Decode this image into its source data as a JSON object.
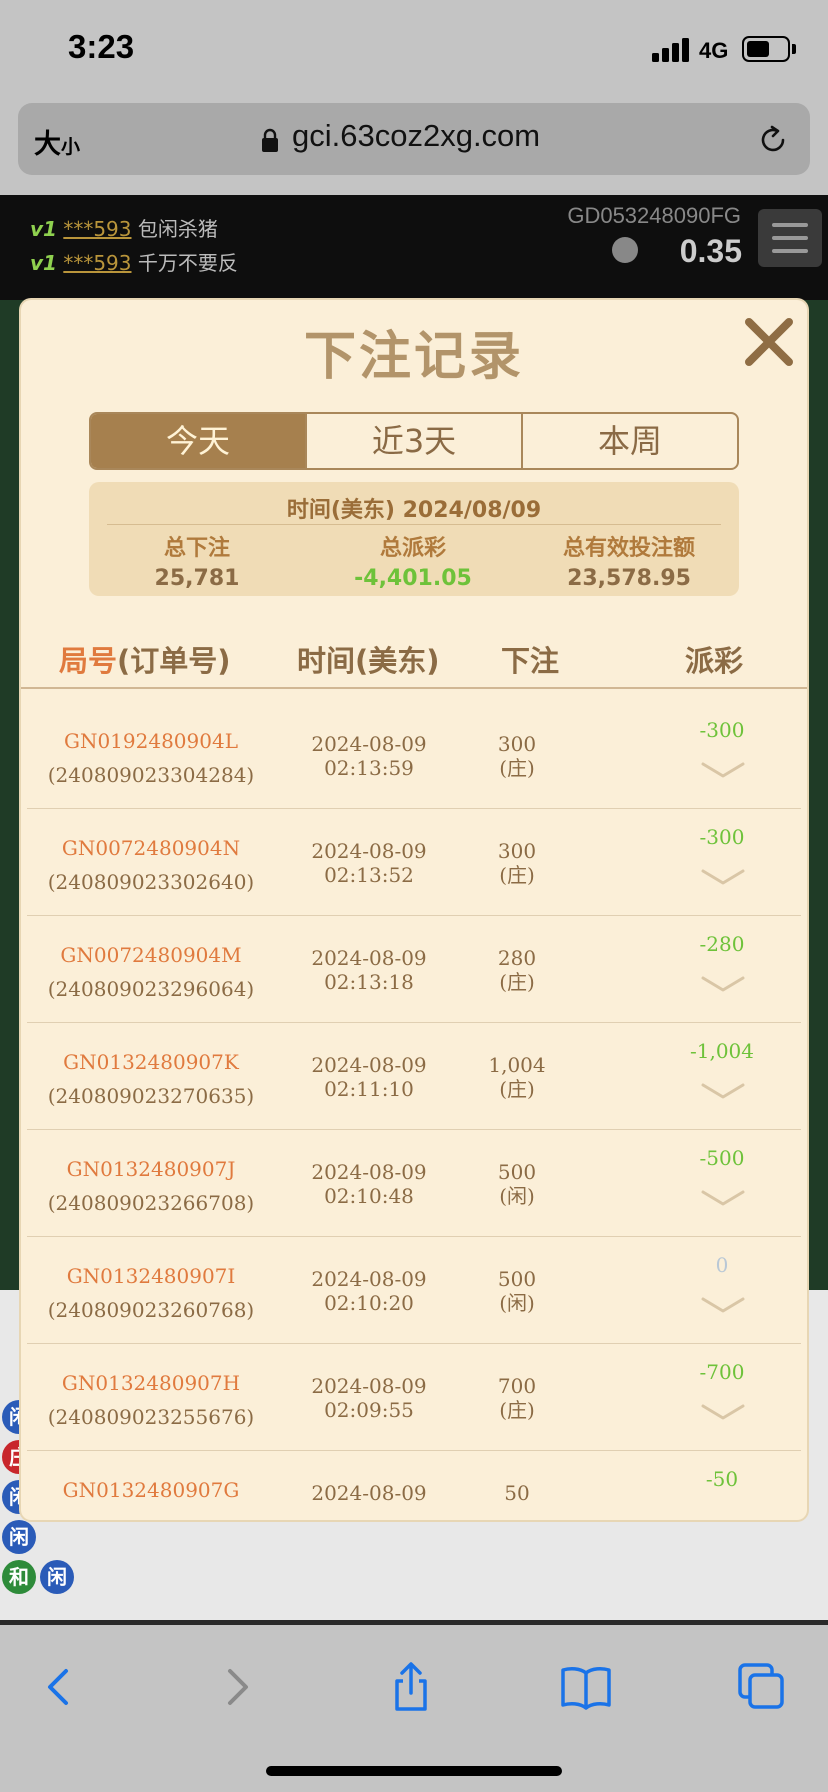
{
  "status": {
    "time": "3:23",
    "network": "4G"
  },
  "browser": {
    "text_size_label": "大",
    "text_size_small": "小",
    "url": "gci.63coz2xg.com"
  },
  "game": {
    "chat": [
      {
        "vip": "v1",
        "user": "***593",
        "message": "包闲杀猪"
      },
      {
        "vip": "v1",
        "user": "***593",
        "message": "千万不要反"
      }
    ],
    "account_id": "GD053248090FG",
    "balance": "0.35",
    "roadmap_labels": [
      "闲",
      "庄",
      "闲",
      "闲",
      "和",
      "闲"
    ]
  },
  "modal": {
    "title": "下注记录",
    "tabs": [
      {
        "label": "今天",
        "active": true
      },
      {
        "label": "近3天",
        "active": false
      },
      {
        "label": "本周",
        "active": false
      }
    ],
    "summary": {
      "date_label": "时间(美东)",
      "date": "2024/08/09",
      "total_bet_label": "总下注",
      "total_bet": "25,781",
      "total_payout_label": "总派彩",
      "total_payout": "-4,401.05",
      "total_valid_label": "总有效投注额",
      "total_valid": "23,578.95"
    },
    "columns": {
      "round_a": "局号",
      "round_b": "(订单号)",
      "time": "时间(美东)",
      "bet": "下注",
      "payout": "派彩"
    },
    "rows": [
      {
        "game_no": "GN0192480904L",
        "order_no": "(240809023304284)",
        "date": "2024-08-09",
        "time": "02:13:59",
        "amount": "300",
        "side": "(庄)",
        "payout": "-300"
      },
      {
        "game_no": "GN0072480904N",
        "order_no": "(240809023302640)",
        "date": "2024-08-09",
        "time": "02:13:52",
        "amount": "300",
        "side": "(庄)",
        "payout": "-300"
      },
      {
        "game_no": "GN0072480904M",
        "order_no": "(240809023296064)",
        "date": "2024-08-09",
        "time": "02:13:18",
        "amount": "280",
        "side": "(庄)",
        "payout": "-280"
      },
      {
        "game_no": "GN0132480907K",
        "order_no": "(240809023270635)",
        "date": "2024-08-09",
        "time": "02:11:10",
        "amount": "1,004",
        "side": "(庄)",
        "payout": "-1,004"
      },
      {
        "game_no": "GN0132480907J",
        "order_no": "(240809023266708)",
        "date": "2024-08-09",
        "time": "02:10:48",
        "amount": "500",
        "side": "(闲)",
        "payout": "-500"
      },
      {
        "game_no": "GN0132480907I",
        "order_no": "(240809023260768)",
        "date": "2024-08-09",
        "time": "02:10:20",
        "amount": "500",
        "side": "(闲)",
        "payout": "0"
      },
      {
        "game_no": "GN0132480907H",
        "order_no": "(240809023255676)",
        "date": "2024-08-09",
        "time": "02:09:55",
        "amount": "700",
        "side": "(庄)",
        "payout": "-700"
      },
      {
        "game_no": "GN0132480907G",
        "order_no": "",
        "date": "2024-08-09",
        "time": "",
        "amount": "50",
        "side": "",
        "payout": "-50"
      }
    ]
  },
  "colors": {
    "accent": "#e07a3e",
    "gold": "#a6804e",
    "loss": "#6ec23a",
    "modal_bg": "#fbefd8"
  },
  "icons": [
    "close-icon",
    "lock-icon",
    "reload-icon",
    "back-icon",
    "forward-icon",
    "share-icon",
    "bookmarks-icon",
    "tabs-icon",
    "chevron-down-icon"
  ]
}
